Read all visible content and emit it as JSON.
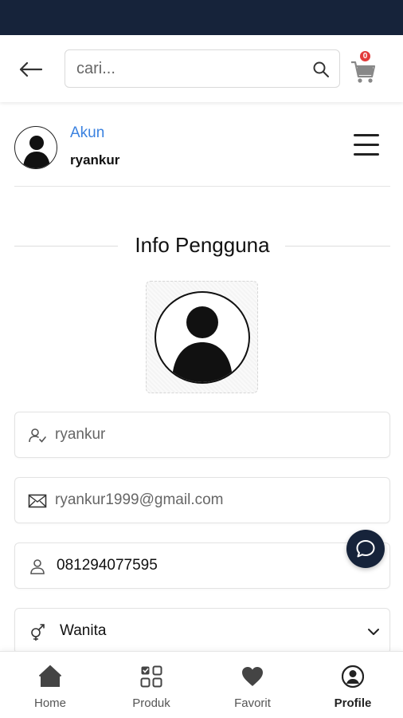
{
  "search": {
    "placeholder": "cari..."
  },
  "cart": {
    "count": "0"
  },
  "account": {
    "label": "Akun",
    "username": "ryankur"
  },
  "section": {
    "title": "Info Pengguna"
  },
  "fields": {
    "username": "ryankur",
    "email": "ryankur1999@gmail.com",
    "phone": "081294077595",
    "gender": "Wanita"
  },
  "nav": [
    {
      "label": "Home",
      "icon": "home-icon"
    },
    {
      "label": "Produk",
      "icon": "grid-icon"
    },
    {
      "label": "Favorit",
      "icon": "heart-icon"
    },
    {
      "label": "Profile",
      "icon": "profile-icon",
      "active": true
    }
  ],
  "colors": {
    "header": "#16233a",
    "accent": "#3b82e0",
    "badge": "#e23b3b"
  }
}
